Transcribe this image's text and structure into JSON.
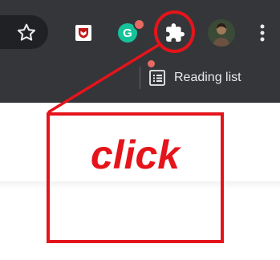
{
  "toolbar": {
    "icons": {
      "bookmark": "star-icon",
      "mcafee": "mcafee-shield-icon",
      "grammarly": "grammarly-icon",
      "extensions": "puzzle-piece-icon",
      "profile": "avatar",
      "menu": "vertical-ellipsis-icon"
    },
    "grammarly_letter": "G"
  },
  "bookmarks_bar": {
    "reading_list_label": "Reading list"
  },
  "annotation": {
    "label": "click",
    "color": "#e5141b"
  },
  "colors": {
    "toolbar_bg": "#35363a",
    "text_light": "#e8eaed",
    "accent_green": "#15c39a",
    "mcafee_red": "#c01818",
    "badge_red": "#e46a63"
  }
}
